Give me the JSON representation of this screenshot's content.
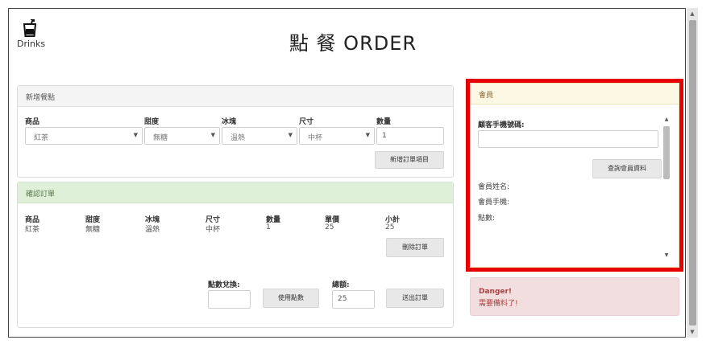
{
  "header": {
    "logo_text": "Drinks",
    "title": "點 餐 ORDER"
  },
  "add_item": {
    "heading": "新增餐點",
    "labels": {
      "product": "商品",
      "sweetness": "甜度",
      "ice": "冰塊",
      "size": "尺寸",
      "quantity": "數量"
    },
    "values": {
      "product": "紅茶",
      "sweetness": "無糖",
      "ice": "溫熱",
      "size": "中杯",
      "quantity": "1"
    },
    "add_button": "新增訂單項目"
  },
  "confirm_order": {
    "heading": "確認訂單",
    "columns": [
      "商品",
      "甜度",
      "冰塊",
      "尺寸",
      "數量",
      "單價",
      "小計"
    ],
    "row": [
      "紅茶",
      "無糖",
      "溫熱",
      "中杯",
      "1",
      "25",
      "25"
    ],
    "delete_button": "刪除訂單",
    "points_label": "點數兌換:",
    "points_value": "",
    "use_points_button": "使用點數",
    "total_label": "總額:",
    "total_value": "25",
    "submit_button": "送出訂單"
  },
  "member": {
    "heading": "會員",
    "phone_label": "顧客手機號碼:",
    "phone_value": "",
    "lookup_button": "查詢會員資料",
    "name_label": "會員姓名:",
    "mobile_label": "會員手機:",
    "points_label": "點數:"
  },
  "alert": {
    "title": "Danger!",
    "message": "需要備料了!"
  },
  "colors": {
    "highlight": "#e60000",
    "confirm_header": "#dff0d8",
    "member_header": "#fcf8e3",
    "alert_bg": "#f2dede"
  }
}
